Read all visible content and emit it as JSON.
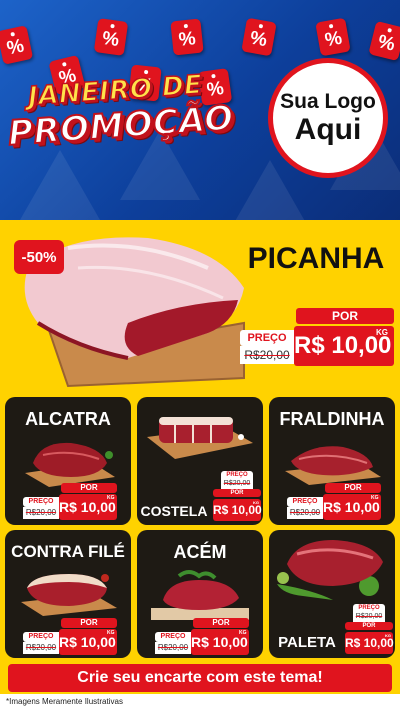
{
  "header": {
    "title_line1": "JANEIRO DE",
    "title_line2": "PROMOÇÃO",
    "tag_symbol": "%",
    "logo_line1": "Sua Logo",
    "logo_line2": "Aqui",
    "colors": {
      "blue": "#1d63c9",
      "red": "#e0141e",
      "yellow": "#ffd200"
    }
  },
  "highlight": {
    "discount": "-50%",
    "name": "PICANHA",
    "price": {
      "preco_label": "PREÇO",
      "por_label": "POR",
      "old": "R$20,00",
      "new": "R$ 10,00",
      "unit": "KG"
    }
  },
  "products": [
    {
      "name": "ALCATRA",
      "preco_label": "PREÇO",
      "por_label": "POR",
      "old": "R$20,00",
      "new": "R$ 10,00",
      "unit": "KG"
    },
    {
      "name": "COSTELA",
      "preco_label": "PREÇO",
      "por_label": "POR",
      "old": "R$20,00",
      "new": "R$ 10,00",
      "unit": "KG"
    },
    {
      "name": "FRALDINHA",
      "preco_label": "PREÇO",
      "por_label": "POR",
      "old": "R$20,00",
      "new": "R$ 10,00",
      "unit": "KG"
    },
    {
      "name": "CONTRA FILÉ",
      "preco_label": "PREÇO",
      "por_label": "POR",
      "old": "R$20,00",
      "new": "R$ 10,00",
      "unit": "KG"
    },
    {
      "name": "ACÉM",
      "preco_label": "PREÇO",
      "por_label": "POR",
      "old": "R$20,00",
      "new": "R$ 10,00",
      "unit": "KG"
    },
    {
      "name": "PALETA",
      "preco_label": "PREÇO",
      "por_label": "POR",
      "old": "R$20,00",
      "new": "R$ 10,00",
      "unit": "KG"
    }
  ],
  "footer": {
    "cta": "Crie seu encarte com este tema!",
    "disclaimer": "*Imagens Meramente Ilustrativas"
  }
}
